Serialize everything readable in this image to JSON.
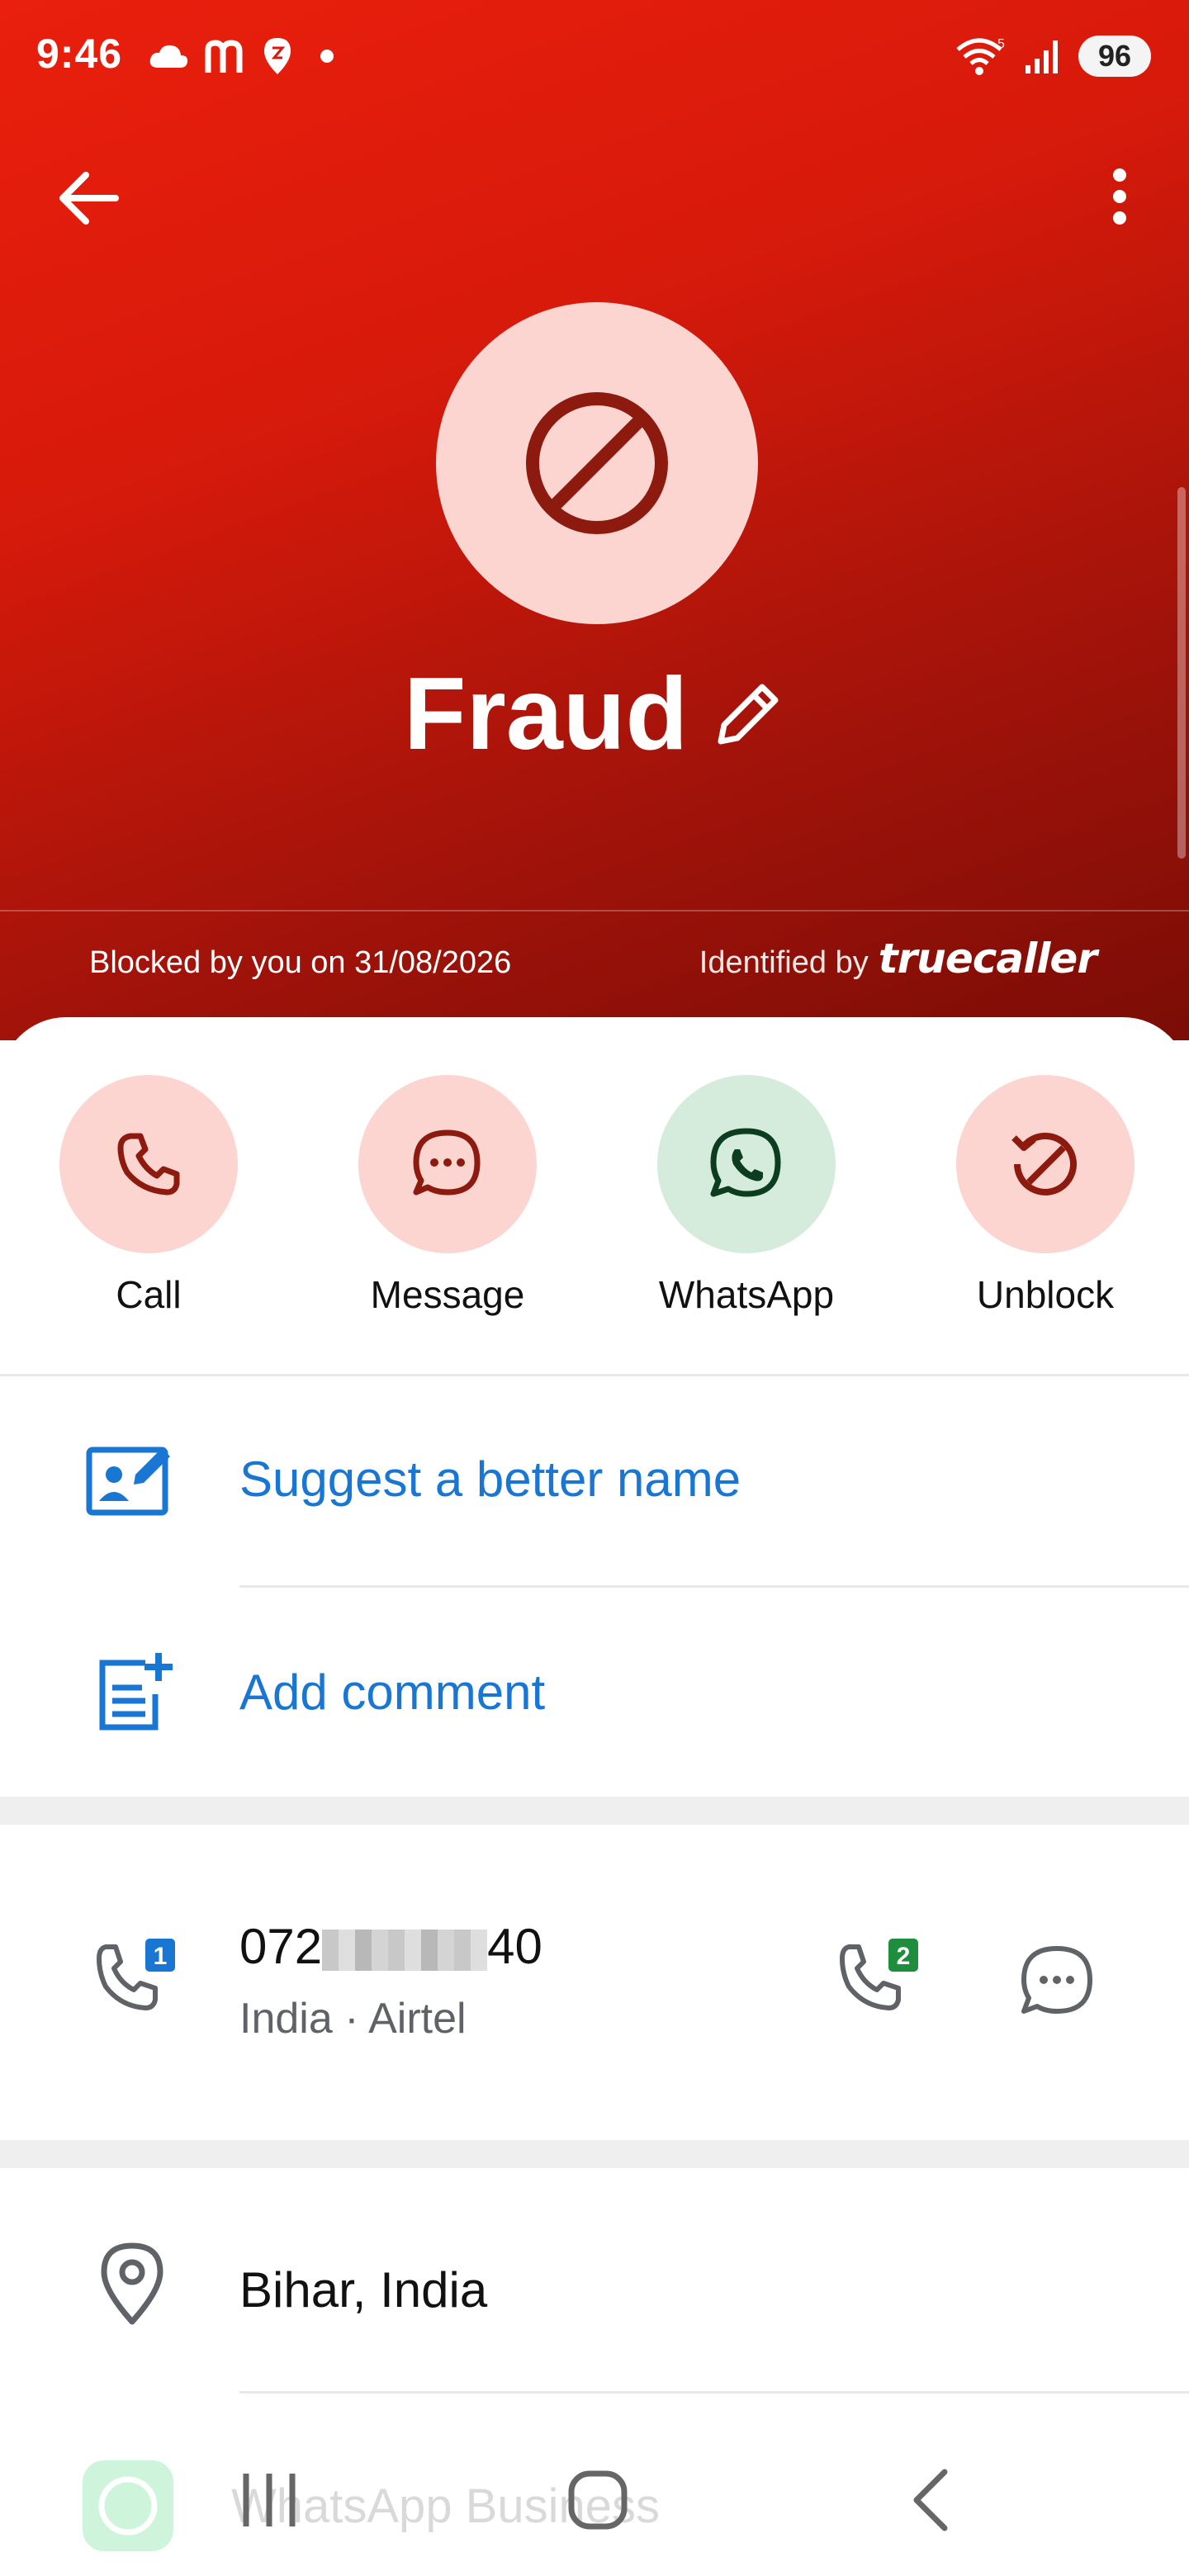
{
  "status_bar": {
    "time": "9:46",
    "battery": "96"
  },
  "contact": {
    "name": "Fraud",
    "blocked_text": "Blocked by you on 31/08/2026",
    "identified_label": "Identified by",
    "identified_brand": "truecaller"
  },
  "actions": [
    {
      "label": "Call"
    },
    {
      "label": "Message"
    },
    {
      "label": "WhatsApp"
    },
    {
      "label": "Unblock"
    }
  ],
  "links": {
    "suggest": "Suggest a better name",
    "comment": "Add comment"
  },
  "phone": {
    "prefix": "072",
    "suffix": "40",
    "details": "India · Airtel",
    "sim1": "1",
    "sim2": "2"
  },
  "location": "Bihar, India",
  "faded_item": "WhatsApp Business",
  "colors": {
    "header_top": "#ea1f0d",
    "header_bottom": "#7a0d06",
    "action_red_bg": "#fcd5d1",
    "action_green_bg": "#d5ecdc",
    "link_blue": "#1976d2"
  }
}
